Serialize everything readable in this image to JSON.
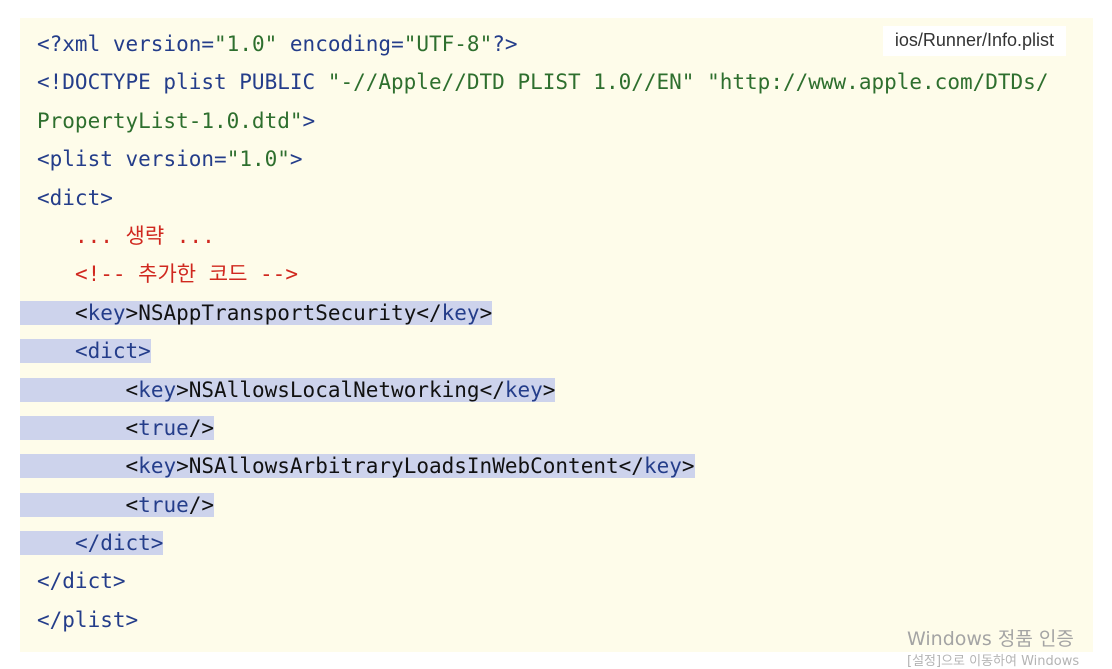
{
  "file_label": "ios/Runner/Info.plist",
  "colors": {
    "background": "#fefcea",
    "highlight": "#cdd3ec",
    "tag": "#243d8a",
    "string": "#2e6f2e",
    "comment": "#d0281f"
  },
  "code": {
    "line1": {
      "open": "<?xml ",
      "attr1": "version",
      "eq1": "=",
      "val1": "\"1.0\"",
      "sp": " ",
      "attr2": "encoding",
      "eq2": "=",
      "val2": "\"UTF-8\"",
      "close": "?>"
    },
    "line2": {
      "open": "<!DOCTYPE plist PUBLIC ",
      "val1": "\"-//Apple//DTD PLIST 1.0//EN\"",
      "sp": " ",
      "val2": "\"http://www.apple.com/DTDs/"
    },
    "line3": {
      "val": "PropertyList-1.0.dtd\"",
      "close": ">"
    },
    "line4": {
      "open": "<plist ",
      "attr": "version",
      "eq": "=",
      "val": "\"1.0\"",
      "close": ">"
    },
    "line5": {
      "tag": "<dict>"
    },
    "line6": {
      "indent": "   ",
      "comment": "... 생략 ..."
    },
    "line7": {
      "indent": "   ",
      "comment": "<!-- 추가한 코드 -->"
    },
    "line8": {
      "indent": "   ",
      "open": "<",
      "tagname": "key",
      "gt": ">",
      "text": "NSAppTransportSecurity",
      "close_open": "</",
      "close_tagname": "key",
      "close_gt": ">"
    },
    "line9": {
      "indent": "   ",
      "tag": "<dict>"
    },
    "line10": {
      "indent": "       ",
      "open": "<",
      "tagname": "key",
      "gt": ">",
      "text": "NSAllowsLocalNetworking",
      "close_open": "</",
      "close_tagname": "key",
      "close_gt": ">"
    },
    "line11": {
      "indent": "       ",
      "open": "<",
      "tagname": "true",
      "close": "/>"
    },
    "line12": {
      "indent": "       ",
      "open": "<",
      "tagname": "key",
      "gt": ">",
      "text": "NSAllowsArbitraryLoadsInWebContent",
      "close_open": "</",
      "close_tagname": "key",
      "close_gt": ">"
    },
    "line13": {
      "indent": "       ",
      "open": "<",
      "tagname": "true",
      "close": "/>"
    },
    "line14": {
      "indent": "   ",
      "tag": "</dict>"
    },
    "line15": {
      "tag": "</dict>"
    },
    "line16": {
      "tag": "</plist>"
    }
  },
  "watermark": {
    "title": "Windows 정품 인증",
    "subtitle": "[설정]으로 이동하여 Windows"
  }
}
